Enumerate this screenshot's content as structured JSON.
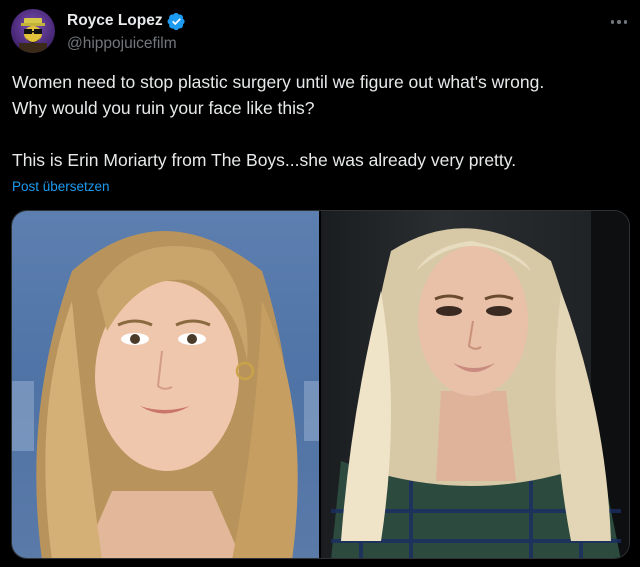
{
  "author": {
    "display_name": "Royce Lopez",
    "handle": "@hippojuicefilm",
    "verified": true,
    "avatar_icon": "cartoon-avatar-icon"
  },
  "tweet": {
    "lines_paragraph1": [
      "Women need to stop plastic surgery until we figure out what's wrong.",
      "Why would you ruin your face like this?"
    ],
    "paragraph2": "This is Erin Moriarty from The Boys...she was already very pretty.",
    "translate_label": "Post übersetzen"
  },
  "media": {
    "images": [
      "photo-left-before",
      "photo-right-after"
    ]
  },
  "colors": {
    "background": "#000000",
    "text": "#e7e9ea",
    "muted": "#71767b",
    "link": "#1d9bf0",
    "verified": "#1d9bf0"
  }
}
